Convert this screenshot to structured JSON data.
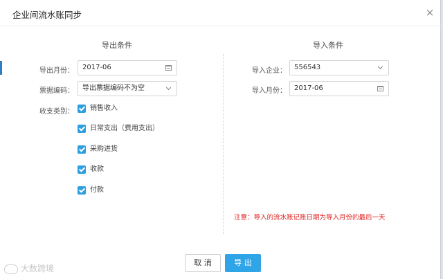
{
  "dialog": {
    "title": "企业间流水账同步",
    "close_glyph": "×"
  },
  "export_section": {
    "title": "导出条件",
    "month_label": "导出月份：",
    "month_value": "2017-06",
    "doc_code_label": "票据编码：",
    "doc_code_value": "导出票据编码不为空",
    "category_label": "收支类别：",
    "categories": [
      {
        "label": "销售收入",
        "checked": true
      },
      {
        "label": "日常支出（费用支出）",
        "checked": true
      },
      {
        "label": "采购进货",
        "checked": true
      },
      {
        "label": "收款",
        "checked": true
      },
      {
        "label": "付款",
        "checked": true
      }
    ]
  },
  "import_section": {
    "title": "导入条件",
    "company_label": "导入企业：",
    "company_value": "556543",
    "month_label": "导入月份：",
    "month_value": "2017-06"
  },
  "notice": "注意：导入的流水账记账日期为导入月份的最后一天",
  "buttons": {
    "cancel": "取 消",
    "export": "导 出"
  },
  "watermark": "大数跨境",
  "colors": {
    "accent": "#2fa4e7",
    "checkbox": "#2d9fe0",
    "notice": "#e02020"
  },
  "icons": {
    "calendar": "calendar-icon",
    "dropdown": "chevron-down-icon",
    "close": "close-icon",
    "check": "checkmark-icon"
  }
}
